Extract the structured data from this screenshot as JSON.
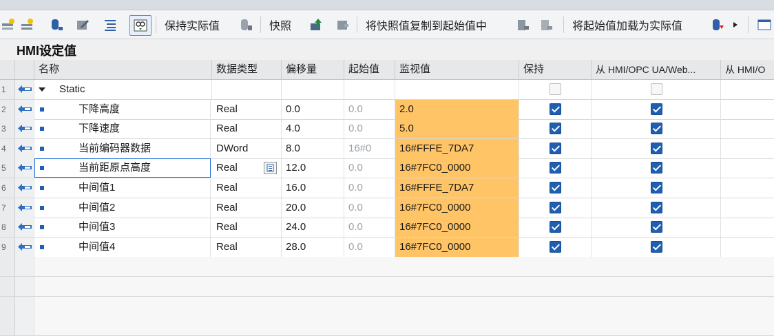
{
  "toolbar": {
    "keep_actual_label": "保持实际值",
    "snapshot_label": "快照",
    "copy_snapshot_label": "将快照值复制到起始值中",
    "load_start_label": "将起始值加载为实际值"
  },
  "section_title": "HMI设定值",
  "columns": [
    "名称",
    "数据类型",
    "偏移量",
    "起始值",
    "监视值",
    "保持",
    "从 HMI/OPC UA/Web...",
    "从 HMI/O"
  ],
  "rows": [
    {
      "num": "1",
      "name": "Static",
      "type": "",
      "offset": "",
      "start": "",
      "monitor": "",
      "retain": false,
      "hmi": false,
      "group": true
    },
    {
      "num": "2",
      "name": "下降高度",
      "type": "Real",
      "offset": "0.0",
      "start": "0.0",
      "monitor": "2.0",
      "retain": true,
      "hmi": true
    },
    {
      "num": "3",
      "name": "下降速度",
      "type": "Real",
      "offset": "4.0",
      "start": "0.0",
      "monitor": "5.0",
      "retain": true,
      "hmi": true
    },
    {
      "num": "4",
      "name": "当前编码器数据",
      "type": "DWord",
      "offset": "8.0",
      "start": "16#0",
      "monitor": "16#FFFE_7DA7",
      "retain": true,
      "hmi": true
    },
    {
      "num": "5",
      "name": "当前距原点高度",
      "type": "Real",
      "offset": "12.0",
      "start": "0.0",
      "monitor": "16#7FC0_0000",
      "retain": true,
      "hmi": true,
      "selected": true
    },
    {
      "num": "6",
      "name": "中间值1",
      "type": "Real",
      "offset": "16.0",
      "start": "0.0",
      "monitor": "16#FFFE_7DA7",
      "retain": true,
      "hmi": true
    },
    {
      "num": "7",
      "name": "中间值2",
      "type": "Real",
      "offset": "20.0",
      "start": "0.0",
      "monitor": "16#7FC0_0000",
      "retain": true,
      "hmi": true
    },
    {
      "num": "8",
      "name": "中间值3",
      "type": "Real",
      "offset": "24.0",
      "start": "0.0",
      "monitor": "16#7FC0_0000",
      "retain": true,
      "hmi": true
    },
    {
      "num": "9",
      "name": "中间值4",
      "type": "Real",
      "offset": "28.0",
      "start": "0.0",
      "monitor": "16#7FC0_0000",
      "retain": true,
      "hmi": true
    }
  ],
  "colors": {
    "monitor_bg": "#ffc466",
    "checkbox_on": "#1f5fb3",
    "selection": "#1e6fd9"
  }
}
